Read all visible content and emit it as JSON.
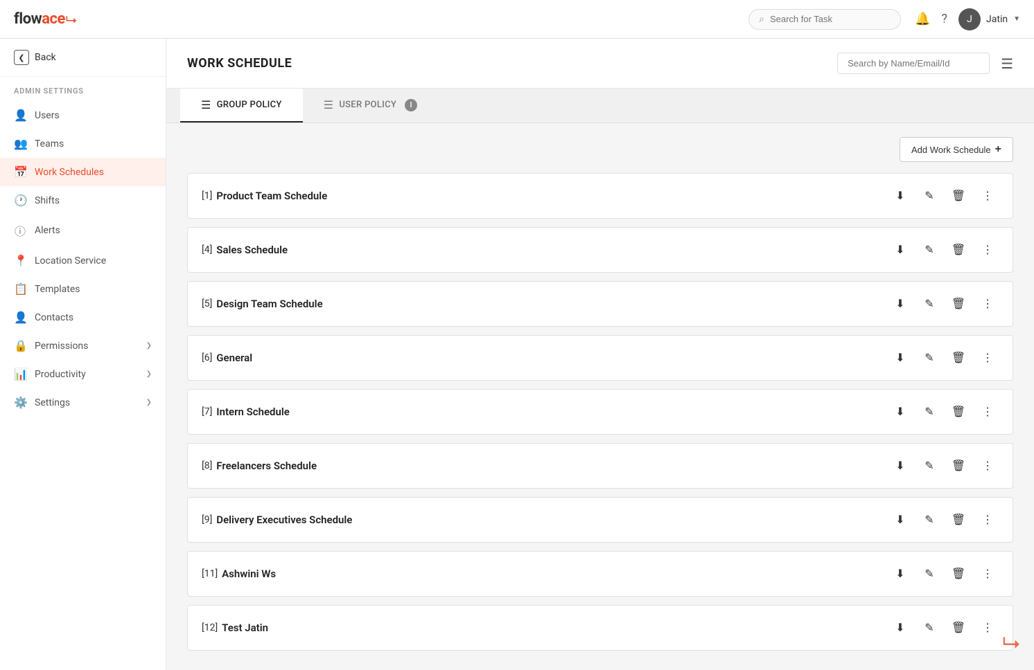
{
  "navbar": {
    "logo_text": "flowace",
    "search_placeholder": "Search for Task",
    "username": "Jatin"
  },
  "sidebar": {
    "back_label": "Back",
    "admin_settings_label": "ADMIN SETTINGS",
    "items": [
      {
        "id": "users",
        "label": "Users",
        "icon": "👤",
        "active": false
      },
      {
        "id": "teams",
        "label": "Teams",
        "icon": "👥",
        "active": false
      },
      {
        "id": "work-schedules",
        "label": "Work Schedules",
        "icon": "📅",
        "active": true
      },
      {
        "id": "shifts",
        "label": "Shifts",
        "icon": "🕐",
        "active": false
      },
      {
        "id": "alerts",
        "label": "Alerts",
        "icon": "ℹ️",
        "active": false
      },
      {
        "id": "location-service",
        "label": "Location Service",
        "icon": "📍",
        "active": false
      },
      {
        "id": "templates",
        "label": "Templates",
        "icon": "📋",
        "active": false
      },
      {
        "id": "contacts",
        "label": "Contacts",
        "icon": "👤",
        "active": false
      },
      {
        "id": "permissions",
        "label": "Permissions",
        "icon": "🔒",
        "active": false,
        "has_chevron": true
      },
      {
        "id": "productivity",
        "label": "Productivity",
        "icon": "📊",
        "active": false,
        "has_chevron": true
      },
      {
        "id": "settings",
        "label": "Settings",
        "icon": "⚙️",
        "active": false,
        "has_chevron": true
      }
    ]
  },
  "page": {
    "title": "WORK SCHEDULE",
    "search_placeholder": "Search by Name/Email/Id"
  },
  "tabs": [
    {
      "id": "group-policy",
      "label": "GROUP POLICY",
      "active": true
    },
    {
      "id": "user-policy",
      "label": "USER POLICY",
      "active": false,
      "has_info": true
    }
  ],
  "add_button_label": "Add Work Schedule",
  "schedules": [
    {
      "id": "[1]",
      "name": "Product Team Schedule"
    },
    {
      "id": "[4]",
      "name": "Sales Schedule"
    },
    {
      "id": "[5]",
      "name": "Design Team Schedule"
    },
    {
      "id": "[6]",
      "name": "General"
    },
    {
      "id": "[7]",
      "name": "Intern Schedule"
    },
    {
      "id": "[8]",
      "name": "Freelancers Schedule"
    },
    {
      "id": "[9]",
      "name": "Delivery Executives Schedule"
    },
    {
      "id": "[11]",
      "name": "Ashwini Ws"
    },
    {
      "id": "[12]",
      "name": "Test Jatin"
    }
  ]
}
